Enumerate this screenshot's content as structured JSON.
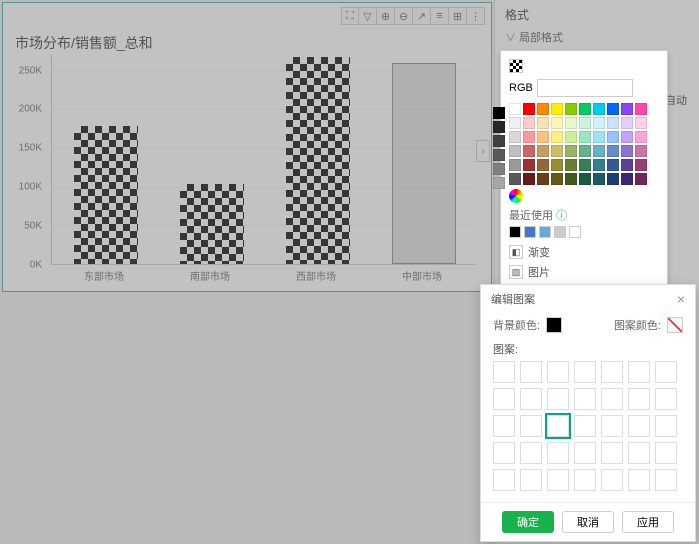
{
  "chart_data": {
    "type": "bar",
    "title": "市场分布/销售额_总和",
    "categories": [
      "东部市场",
      "南部市场",
      "西部市场",
      "中部市场"
    ],
    "values": [
      178000,
      103000,
      267000,
      260000
    ],
    "ylabel": "",
    "xlabel": "",
    "ylim": [
      0,
      270000
    ],
    "yticks": [
      "0K",
      "50K",
      "100K",
      "150K",
      "200K",
      "250K"
    ],
    "selected_bar_index": 3
  },
  "toolbar_icons": [
    "fullscreen-icon",
    "filter-icon",
    "zoom-in-icon",
    "zoom-out-icon",
    "export-icon",
    "column-icon",
    "share-icon",
    "more-icon"
  ],
  "right_panel": {
    "title": "格式",
    "section": "局部格式",
    "auto_label": "自动",
    "auto_checked": true
  },
  "color_popover": {
    "rgb_label": "RGB",
    "rgb_value": "",
    "recent_label": "最近使用",
    "recent_colors": [
      "#000000",
      "#4477cc",
      "#66aadd",
      "#cccccc",
      "#ffffff"
    ],
    "options": {
      "gradient": "渐变",
      "image": "图片",
      "pattern": "图案"
    },
    "palette_main": [
      "#ffffff",
      "#ff0000",
      "#ff8800",
      "#ffee00",
      "#88cc00",
      "#00cc66",
      "#00ccee",
      "#0066ff",
      "#8844ff",
      "#ff44aa",
      "#f0f0f0",
      "#ffcccc",
      "#ffe0b3",
      "#fff7b3",
      "#e6f7cc",
      "#ccf2e0",
      "#ccf2fb",
      "#cce0ff",
      "#e0d1ff",
      "#ffd1ea",
      "#d9d9d9",
      "#ff9999",
      "#ffc180",
      "#fff080",
      "#ccef99",
      "#99e6c1",
      "#99e6f7",
      "#99c1ff",
      "#c1a3ff",
      "#ffa3d5",
      "#bfbfbf",
      "#cc6666",
      "#cc9a66",
      "#ccbf66",
      "#99b366",
      "#66b38c",
      "#66b3c5",
      "#668ccc",
      "#8c73cc",
      "#cc73a6",
      "#999999",
      "#993333",
      "#996633",
      "#998c33",
      "#668033",
      "#338059",
      "#338092",
      "#335999",
      "#594099",
      "#994073",
      "#595959",
      "#661a1a",
      "#66401a",
      "#665c1a",
      "#405c1a",
      "#1a5c40",
      "#1a5c66",
      "#1a4073",
      "#402673",
      "#732659"
    ],
    "palette_side": [
      "#000000",
      "#262626",
      "#404040",
      "#595959",
      "#808080",
      "#a6a6a6"
    ]
  },
  "pattern_dialog": {
    "title": "编辑图案",
    "bg_label": "背景颜色:",
    "bg_color": "#000000",
    "pat_label": "图案颜色:",
    "grid_label": "图案:",
    "selected_index": 16,
    "buttons": {
      "ok": "确定",
      "cancel": "取消",
      "apply": "应用"
    }
  }
}
